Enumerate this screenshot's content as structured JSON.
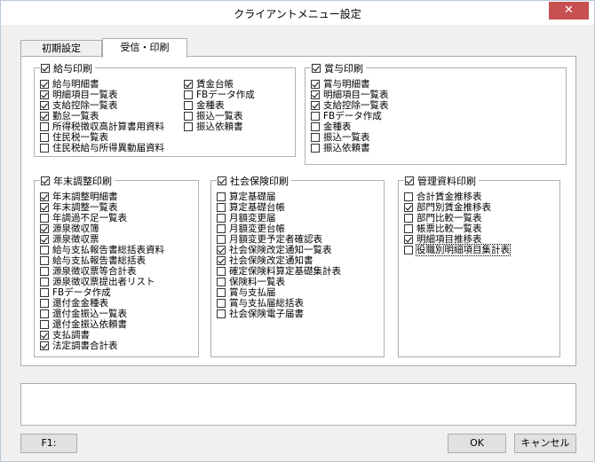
{
  "window": {
    "title": "クライアントメニュー設定",
    "close_label": "✕"
  },
  "tabs": [
    {
      "label": "初期設定"
    },
    {
      "label": "受信・印刷"
    }
  ],
  "groups": {
    "salary": {
      "title": "給与印刷",
      "checked": true,
      "col1": [
        {
          "label": "給与明細書",
          "checked": true
        },
        {
          "label": "明細項目一覧表",
          "checked": true
        },
        {
          "label": "支給控除一覧表",
          "checked": true
        },
        {
          "label": "勤怠一覧表",
          "checked": true
        },
        {
          "label": "所得税徴収高計算書用資料",
          "checked": false
        },
        {
          "label": "住民税一覧表",
          "checked": false
        },
        {
          "label": "住民税給与所得異動届資料",
          "checked": false
        }
      ],
      "col2": [
        {
          "label": "賃金台帳",
          "checked": true
        },
        {
          "label": "FBデータ作成",
          "checked": false
        },
        {
          "label": "金種表",
          "checked": false
        },
        {
          "label": "振込一覧表",
          "checked": false
        },
        {
          "label": "振込依頼書",
          "checked": false
        }
      ]
    },
    "bonus": {
      "title": "賞与印刷",
      "checked": true,
      "items": [
        {
          "label": "賞与明細書",
          "checked": true
        },
        {
          "label": "明細項目一覧表",
          "checked": true
        },
        {
          "label": "支給控除一覧表",
          "checked": true
        },
        {
          "label": "FBデータ作成",
          "checked": false
        },
        {
          "label": "金種表",
          "checked": false
        },
        {
          "label": "振込一覧表",
          "checked": false
        },
        {
          "label": "振込依頼書",
          "checked": false
        }
      ]
    },
    "yearend": {
      "title": "年末調整印刷",
      "checked": true,
      "items": [
        {
          "label": "年末調整明細書",
          "checked": true
        },
        {
          "label": "年末調整一覧表",
          "checked": true
        },
        {
          "label": "年調過不足一覧表",
          "checked": false
        },
        {
          "label": "源泉徴収簿",
          "checked": true
        },
        {
          "label": "源泉徴収票",
          "checked": true
        },
        {
          "label": "給与支払報告書総括表資料",
          "checked": false
        },
        {
          "label": "給与支払報告書総括表",
          "checked": false
        },
        {
          "label": "源泉徴収票等合計表",
          "checked": false
        },
        {
          "label": "源泉徴収票提出者リスト",
          "checked": false
        },
        {
          "label": "FBデータ作成",
          "checked": false
        },
        {
          "label": "還付金金種表",
          "checked": false
        },
        {
          "label": "還付金振込一覧表",
          "checked": false
        },
        {
          "label": "還付金振込依頼書",
          "checked": false
        },
        {
          "label": "支払調書",
          "checked": true
        },
        {
          "label": "法定調書合計表",
          "checked": true
        }
      ]
    },
    "social": {
      "title": "社会保険印刷",
      "checked": true,
      "items": [
        {
          "label": "算定基礎届",
          "checked": false
        },
        {
          "label": "算定基礎台帳",
          "checked": false
        },
        {
          "label": "月額変更届",
          "checked": false
        },
        {
          "label": "月額変更台帳",
          "checked": false
        },
        {
          "label": "月額変更予定者確認表",
          "checked": false
        },
        {
          "label": "社会保険改定通知一覧表",
          "checked": true
        },
        {
          "label": "社会保険改定通知書",
          "checked": true
        },
        {
          "label": "確定保険料算定基礎集計表",
          "checked": false
        },
        {
          "label": "保険料一覧表",
          "checked": false
        },
        {
          "label": "賞与支払届",
          "checked": false
        },
        {
          "label": "賞与支払届総括表",
          "checked": false
        },
        {
          "label": "社会保険電子届書",
          "checked": false
        }
      ]
    },
    "management": {
      "title": "管理資料印刷",
      "checked": true,
      "items": [
        {
          "label": "合計賃金推移表",
          "checked": false
        },
        {
          "label": "部門別賃金推移表",
          "checked": true
        },
        {
          "label": "部門比較一覧表",
          "checked": false
        },
        {
          "label": "帳票比較一覧表",
          "checked": false
        },
        {
          "label": "明細項目推移表",
          "checked": true
        },
        {
          "label": "役職別明細項目集計表",
          "checked": false
        }
      ]
    }
  },
  "footer": {
    "f1_label": "F1:",
    "ok_label": "OK",
    "cancel_label": "キャンセル"
  }
}
